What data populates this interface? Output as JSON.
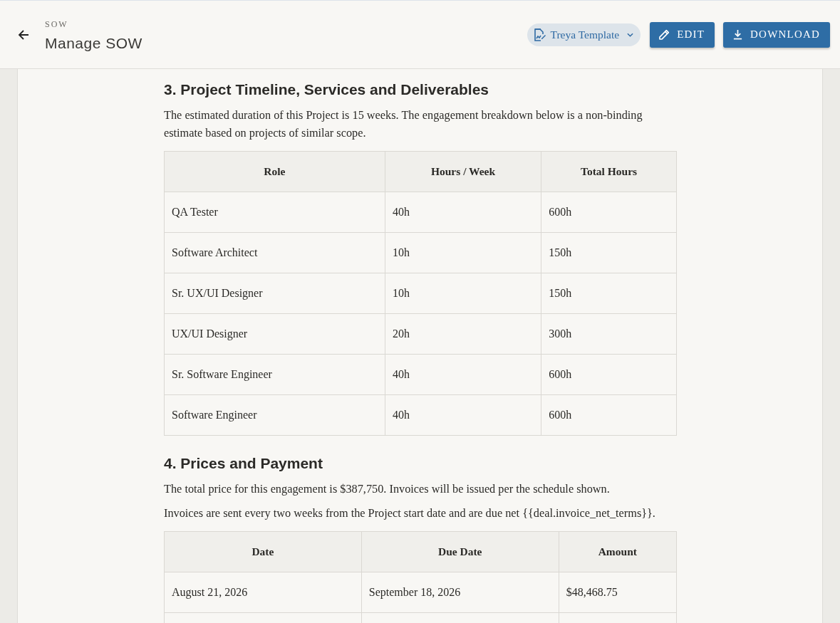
{
  "header": {
    "breadcrumb": "SOW",
    "title": "Manage SOW",
    "template_selector": {
      "label": "Treya Template"
    },
    "buttons": [
      {
        "label": "EDIT",
        "kind": "edit"
      },
      {
        "label": "DOWNLOAD",
        "kind": "download"
      }
    ]
  },
  "document": {
    "sections": [
      {
        "heading": "3. Project Timeline, Services and Deliverables",
        "paragraphs": [
          "The estimated duration of this Project is 15 weeks. The engagement breakdown below is a non-binding estimate based on projects of similar scope."
        ],
        "table": {
          "columns": [
            "Role",
            "Hours / Week",
            "Total Hours"
          ],
          "rows": [
            [
              "QA Tester",
              "40h",
              "600h"
            ],
            [
              "Software Architect",
              "10h",
              "150h"
            ],
            [
              "Sr. UX/UI Designer",
              "10h",
              "150h"
            ],
            [
              "UX/UI Designer",
              "20h",
              "300h"
            ],
            [
              "Sr. Software Engineer",
              "40h",
              "600h"
            ],
            [
              "Software Engineer",
              "40h",
              "600h"
            ]
          ]
        }
      },
      {
        "heading": "4. Prices and Payment",
        "paragraphs": [
          "The total price for this engagement is $387,750. Invoices will be issued per the schedule shown.",
          "Invoices are sent every two weeks from the Project start date and are due net {{deal.invoice_net_terms}}."
        ],
        "table": {
          "columns": [
            "Date",
            "Due Date",
            "Amount"
          ],
          "rows": [
            [
              "August 21, 2026",
              "September 18, 2026",
              "$48,468.75"
            ]
          ]
        }
      }
    ]
  }
}
